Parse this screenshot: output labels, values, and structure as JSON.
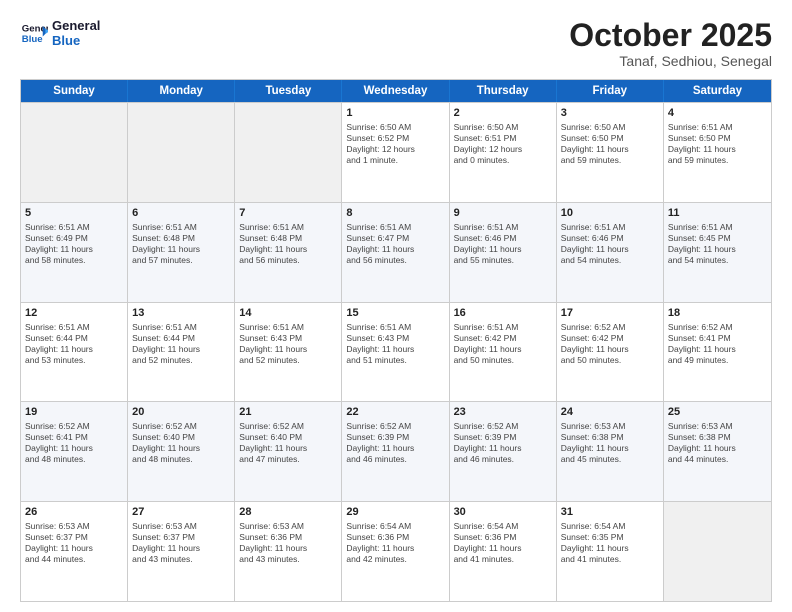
{
  "logo": {
    "line1": "General",
    "line2": "Blue"
  },
  "title": "October 2025",
  "subtitle": "Tanaf, Sedhiou, Senegal",
  "days": [
    "Sunday",
    "Monday",
    "Tuesday",
    "Wednesday",
    "Thursday",
    "Friday",
    "Saturday"
  ],
  "weeks": [
    [
      {
        "date": "",
        "info": ""
      },
      {
        "date": "",
        "info": ""
      },
      {
        "date": "",
        "info": ""
      },
      {
        "date": "1",
        "info": "Sunrise: 6:50 AM\nSunset: 6:52 PM\nDaylight: 12 hours\nand 1 minute."
      },
      {
        "date": "2",
        "info": "Sunrise: 6:50 AM\nSunset: 6:51 PM\nDaylight: 12 hours\nand 0 minutes."
      },
      {
        "date": "3",
        "info": "Sunrise: 6:50 AM\nSunset: 6:50 PM\nDaylight: 11 hours\nand 59 minutes."
      },
      {
        "date": "4",
        "info": "Sunrise: 6:51 AM\nSunset: 6:50 PM\nDaylight: 11 hours\nand 59 minutes."
      }
    ],
    [
      {
        "date": "5",
        "info": "Sunrise: 6:51 AM\nSunset: 6:49 PM\nDaylight: 11 hours\nand 58 minutes."
      },
      {
        "date": "6",
        "info": "Sunrise: 6:51 AM\nSunset: 6:48 PM\nDaylight: 11 hours\nand 57 minutes."
      },
      {
        "date": "7",
        "info": "Sunrise: 6:51 AM\nSunset: 6:48 PM\nDaylight: 11 hours\nand 56 minutes."
      },
      {
        "date": "8",
        "info": "Sunrise: 6:51 AM\nSunset: 6:47 PM\nDaylight: 11 hours\nand 56 minutes."
      },
      {
        "date": "9",
        "info": "Sunrise: 6:51 AM\nSunset: 6:46 PM\nDaylight: 11 hours\nand 55 minutes."
      },
      {
        "date": "10",
        "info": "Sunrise: 6:51 AM\nSunset: 6:46 PM\nDaylight: 11 hours\nand 54 minutes."
      },
      {
        "date": "11",
        "info": "Sunrise: 6:51 AM\nSunset: 6:45 PM\nDaylight: 11 hours\nand 54 minutes."
      }
    ],
    [
      {
        "date": "12",
        "info": "Sunrise: 6:51 AM\nSunset: 6:44 PM\nDaylight: 11 hours\nand 53 minutes."
      },
      {
        "date": "13",
        "info": "Sunrise: 6:51 AM\nSunset: 6:44 PM\nDaylight: 11 hours\nand 52 minutes."
      },
      {
        "date": "14",
        "info": "Sunrise: 6:51 AM\nSunset: 6:43 PM\nDaylight: 11 hours\nand 52 minutes."
      },
      {
        "date": "15",
        "info": "Sunrise: 6:51 AM\nSunset: 6:43 PM\nDaylight: 11 hours\nand 51 minutes."
      },
      {
        "date": "16",
        "info": "Sunrise: 6:51 AM\nSunset: 6:42 PM\nDaylight: 11 hours\nand 50 minutes."
      },
      {
        "date": "17",
        "info": "Sunrise: 6:52 AM\nSunset: 6:42 PM\nDaylight: 11 hours\nand 50 minutes."
      },
      {
        "date": "18",
        "info": "Sunrise: 6:52 AM\nSunset: 6:41 PM\nDaylight: 11 hours\nand 49 minutes."
      }
    ],
    [
      {
        "date": "19",
        "info": "Sunrise: 6:52 AM\nSunset: 6:41 PM\nDaylight: 11 hours\nand 48 minutes."
      },
      {
        "date": "20",
        "info": "Sunrise: 6:52 AM\nSunset: 6:40 PM\nDaylight: 11 hours\nand 48 minutes."
      },
      {
        "date": "21",
        "info": "Sunrise: 6:52 AM\nSunset: 6:40 PM\nDaylight: 11 hours\nand 47 minutes."
      },
      {
        "date": "22",
        "info": "Sunrise: 6:52 AM\nSunset: 6:39 PM\nDaylight: 11 hours\nand 46 minutes."
      },
      {
        "date": "23",
        "info": "Sunrise: 6:52 AM\nSunset: 6:39 PM\nDaylight: 11 hours\nand 46 minutes."
      },
      {
        "date": "24",
        "info": "Sunrise: 6:53 AM\nSunset: 6:38 PM\nDaylight: 11 hours\nand 45 minutes."
      },
      {
        "date": "25",
        "info": "Sunrise: 6:53 AM\nSunset: 6:38 PM\nDaylight: 11 hours\nand 44 minutes."
      }
    ],
    [
      {
        "date": "26",
        "info": "Sunrise: 6:53 AM\nSunset: 6:37 PM\nDaylight: 11 hours\nand 44 minutes."
      },
      {
        "date": "27",
        "info": "Sunrise: 6:53 AM\nSunset: 6:37 PM\nDaylight: 11 hours\nand 43 minutes."
      },
      {
        "date": "28",
        "info": "Sunrise: 6:53 AM\nSunset: 6:36 PM\nDaylight: 11 hours\nand 43 minutes."
      },
      {
        "date": "29",
        "info": "Sunrise: 6:54 AM\nSunset: 6:36 PM\nDaylight: 11 hours\nand 42 minutes."
      },
      {
        "date": "30",
        "info": "Sunrise: 6:54 AM\nSunset: 6:36 PM\nDaylight: 11 hours\nand 41 minutes."
      },
      {
        "date": "31",
        "info": "Sunrise: 6:54 AM\nSunset: 6:35 PM\nDaylight: 11 hours\nand 41 minutes."
      },
      {
        "date": "",
        "info": ""
      }
    ]
  ]
}
